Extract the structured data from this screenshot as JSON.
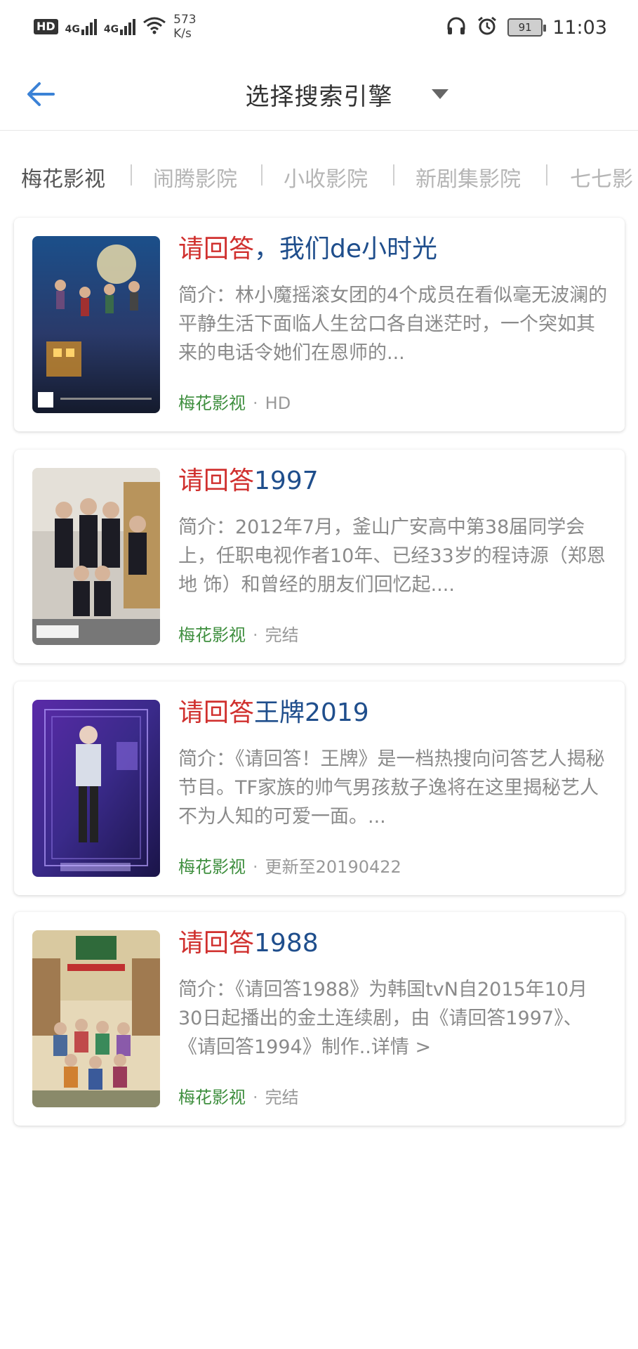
{
  "status_bar": {
    "hd": "HD",
    "net1": "4G",
    "net2": "4G",
    "speed_value": "573",
    "speed_unit": "K/s",
    "battery": "91",
    "time": "11:03"
  },
  "appbar": {
    "title": "选择搜索引擎"
  },
  "tabs": [
    "梅花影视",
    "闹腾影院",
    "小收影院",
    "新剧集影院",
    "七七影"
  ],
  "results": [
    {
      "title_highlight": "请回答",
      "title_rest": "，我们de小时光",
      "desc": "简介：林小魔摇滚女团的4个成员在看似毫无波澜的平静生活下面临人生岔口各自迷茫时，一个突如其来的电话令她们在恩师的...",
      "source": "梅花影视",
      "separator": "·",
      "status": "HD"
    },
    {
      "title_highlight": "请回答",
      "title_rest": "1997",
      "desc": "简介：2012年7月，釜山广安高中第38届同学会上，任职电视作者10年、已经33岁的程诗源（郑恩地 饰）和曾经的朋友们回忆起....",
      "source": "梅花影视",
      "separator": "·",
      "status": "完结"
    },
    {
      "title_highlight": "请回答",
      "title_rest": "王牌2019",
      "desc": "简介：《请回答！王牌》是一档热搜向问答艺人揭秘节目。TF家族的帅气男孩敖子逸将在这里揭秘艺人不为人知的可爱一面。...",
      "source": "梅花影视",
      "separator": "·",
      "status": "更新至20190422"
    },
    {
      "title_highlight": "请回答",
      "title_rest": "1988",
      "desc": "简介：《请回答1988》为韩国tvN自2015年10月30日起播出的金土连续剧，由《请回答1997》、《请回答1994》制作..详情 >",
      "source": "梅花影视",
      "separator": "·",
      "status": "完结"
    }
  ],
  "colors": {
    "accent_blue": "#3b82d6",
    "highlight_red": "#d0302e",
    "title_blue": "#1f4e8c",
    "source_green": "#3f8f3f"
  }
}
